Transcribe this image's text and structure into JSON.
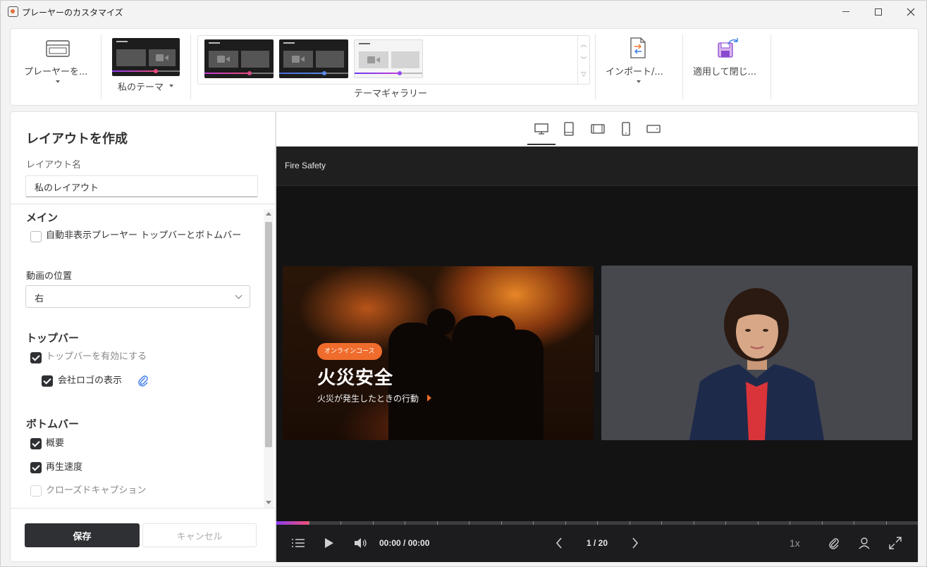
{
  "window": {
    "title": "プレーヤーのカスタマイズ"
  },
  "ribbon": {
    "player_label": "プレーヤーを...",
    "my_theme_label": "私のテーマ",
    "gallery_label": "テーマギャラリー",
    "import_label": "インポート/...",
    "apply_label": "適用して閉じ..."
  },
  "theme_colors": {
    "my_theme": "#e54a7a",
    "gallery_1": "#d84a8a",
    "gallery_2": "#5a8ae8",
    "gallery_3": "#9a4af0"
  },
  "left": {
    "title": "レイアウトを作成",
    "layout_name_label": "レイアウト名",
    "layout_name_value": "私のレイアウト",
    "main_heading": "メイン",
    "auto_hide_label": "自動非表示プレーヤー トップバーとボトムバー",
    "auto_hide_checked": false,
    "video_position_label": "動画の位置",
    "video_position_value": "右",
    "topbar_heading": "トップバー",
    "topbar_enable_label": "トップバーを有効にする",
    "topbar_enable_checked": true,
    "company_logo_label": "会社ロゴの表示",
    "company_logo_checked": true,
    "bottombar_heading": "ボトムバー",
    "summary_label": "概要",
    "summary_checked": true,
    "playback_speed_label": "再生速度",
    "playback_speed_checked": true,
    "closed_caption_label": "クローズドキャプション",
    "closed_caption_checked": false,
    "save_label": "保存",
    "cancel_label": "キャンセル"
  },
  "preview": {
    "devices": [
      "desktop-icon",
      "tablet-portrait-icon",
      "tablet-landscape-icon",
      "phone-portrait-icon",
      "phone-landscape-icon"
    ],
    "player_title": "Fire Safety",
    "slide": {
      "badge": "オンラインコース",
      "title": "火災安全",
      "subtitle": "火災が発生したときの行動"
    },
    "time": "00:00 / 00:00",
    "page": "1 / 20",
    "speed": "1x",
    "progress": 0.05
  }
}
